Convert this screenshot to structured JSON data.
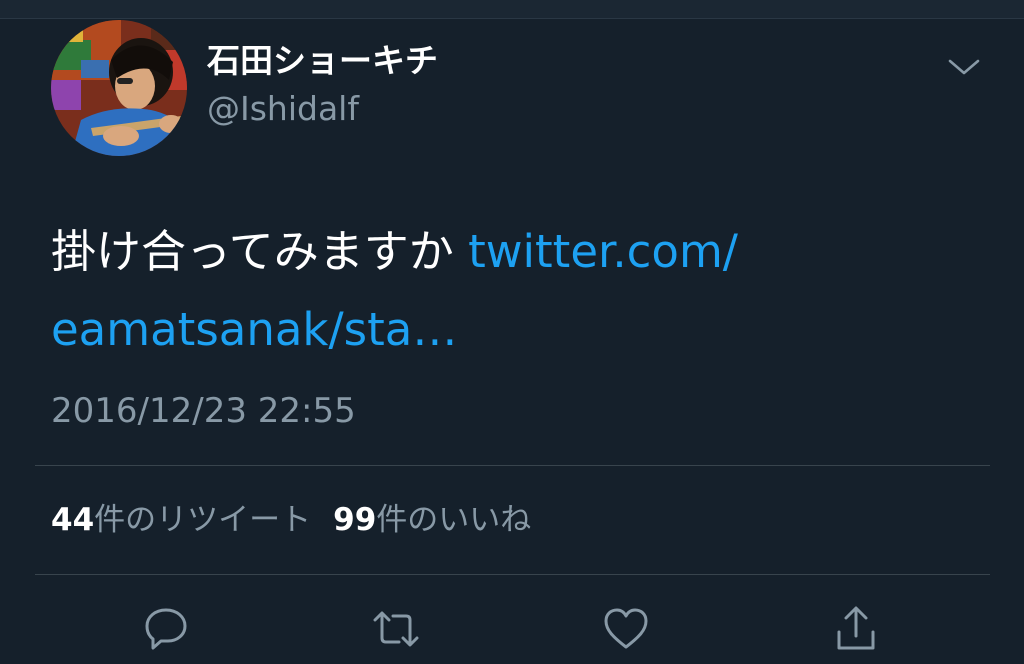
{
  "tweet": {
    "author": {
      "display_name": "石田ショーキチ",
      "handle": "@Ishidalf"
    },
    "text": "掛け合ってみますか",
    "link_line1": "twitter.com/",
    "link_line2": "eamatsanak/sta…",
    "timestamp": "2016/12/23 22:55",
    "stats": {
      "retweet_count": "44",
      "retweet_label": "件のリツイート",
      "like_count": "99",
      "like_label": "件のいいね"
    }
  },
  "icons": {
    "menu": "chevron-down-icon",
    "reply": "reply-icon",
    "retweet": "retweet-icon",
    "like": "heart-icon",
    "share": "share-icon"
  },
  "colors": {
    "background": "#15202b",
    "link": "#1da1f2",
    "secondary_text": "#8899a6",
    "divider": "#38444d"
  }
}
